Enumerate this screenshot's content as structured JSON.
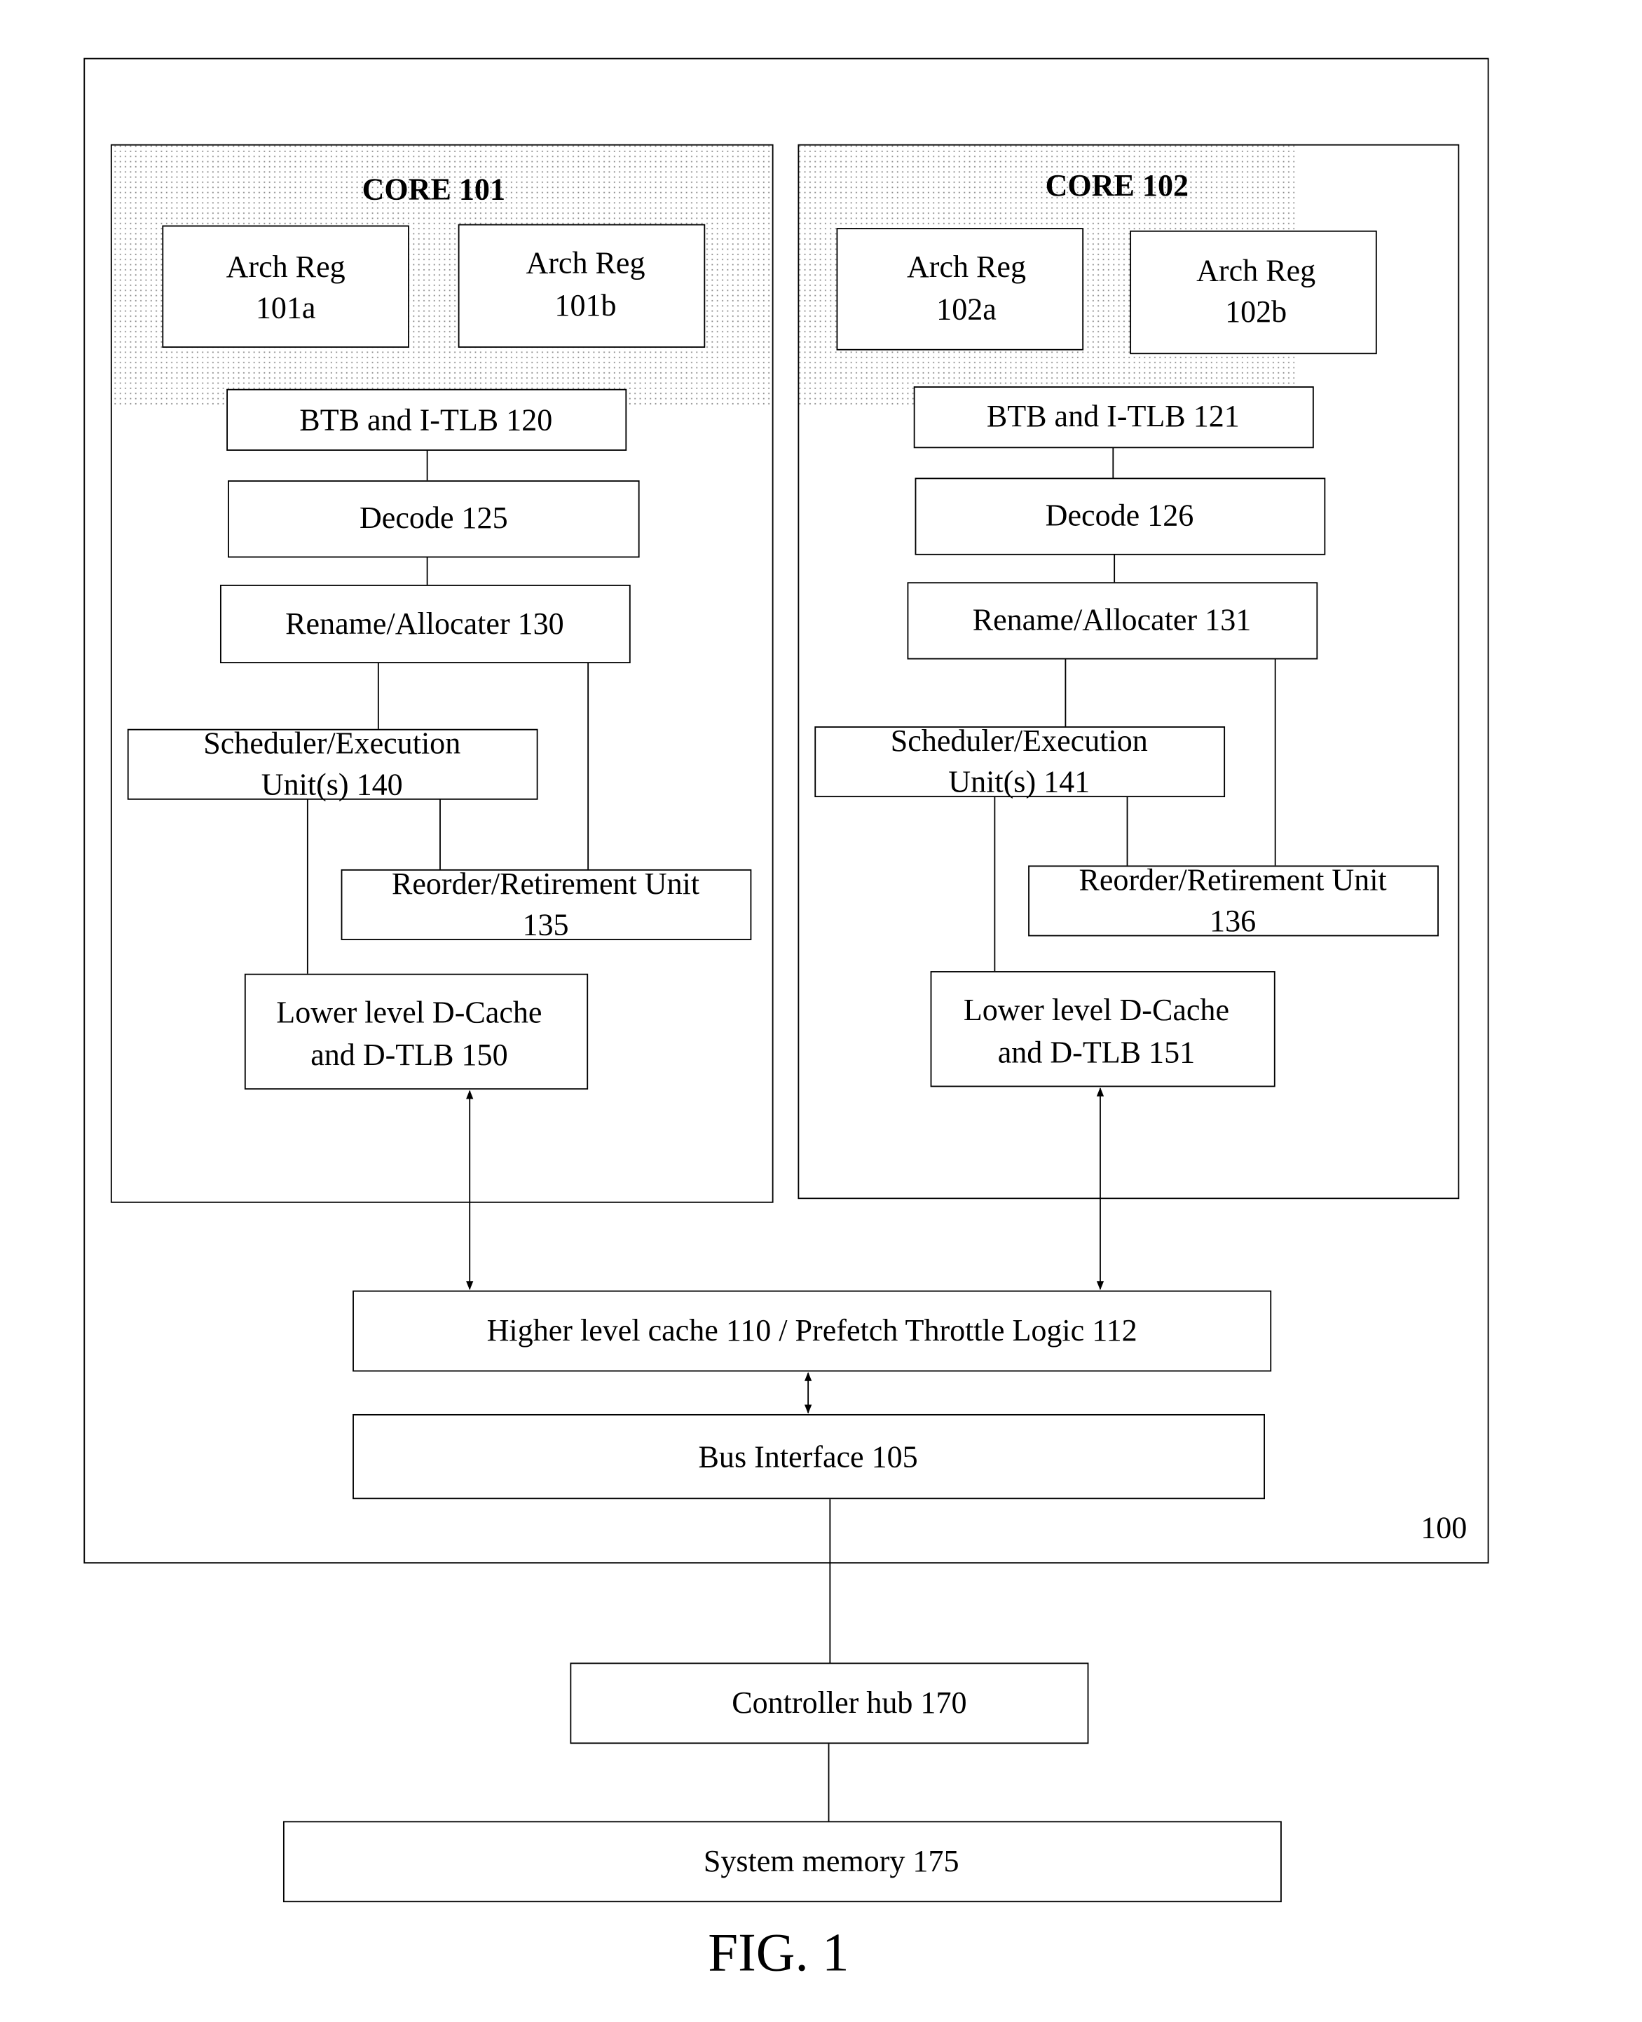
{
  "figure": {
    "caption": "FIG. 1",
    "processor_label": "100"
  },
  "cores": [
    {
      "title": "CORE 101",
      "arch_reg_a": [
        "Arch Reg",
        "101a"
      ],
      "arch_reg_b": [
        "Arch Reg",
        "101b"
      ],
      "btb": "BTB and I-TLB 120",
      "decode": "Decode 125",
      "rename": "Rename/Allocater 130",
      "scheduler": [
        "Scheduler/Execution",
        "Unit(s) 140"
      ],
      "reorder": [
        "Reorder/Retirement Unit",
        "135"
      ],
      "dcache": [
        "Lower level D-Cache",
        "and D-TLB 150"
      ]
    },
    {
      "title": "CORE 102",
      "arch_reg_a": [
        "Arch Reg",
        "102a"
      ],
      "arch_reg_b": [
        "Arch Reg",
        "102b"
      ],
      "btb": "BTB and I-TLB 121",
      "decode": "Decode 126",
      "rename": "Rename/Allocater 131",
      "scheduler": [
        "Scheduler/Execution",
        "Unit(s) 141"
      ],
      "reorder": [
        "Reorder/Retirement Unit",
        "136"
      ],
      "dcache": [
        "Lower level D-Cache",
        "and D-TLB 151"
      ]
    }
  ],
  "shared": {
    "higher_cache": "Higher level cache 110 / Prefetch Throttle Logic 112",
    "bus_interface": "Bus Interface 105",
    "controller_hub": "Controller hub 170",
    "system_memory": "System memory 175"
  }
}
